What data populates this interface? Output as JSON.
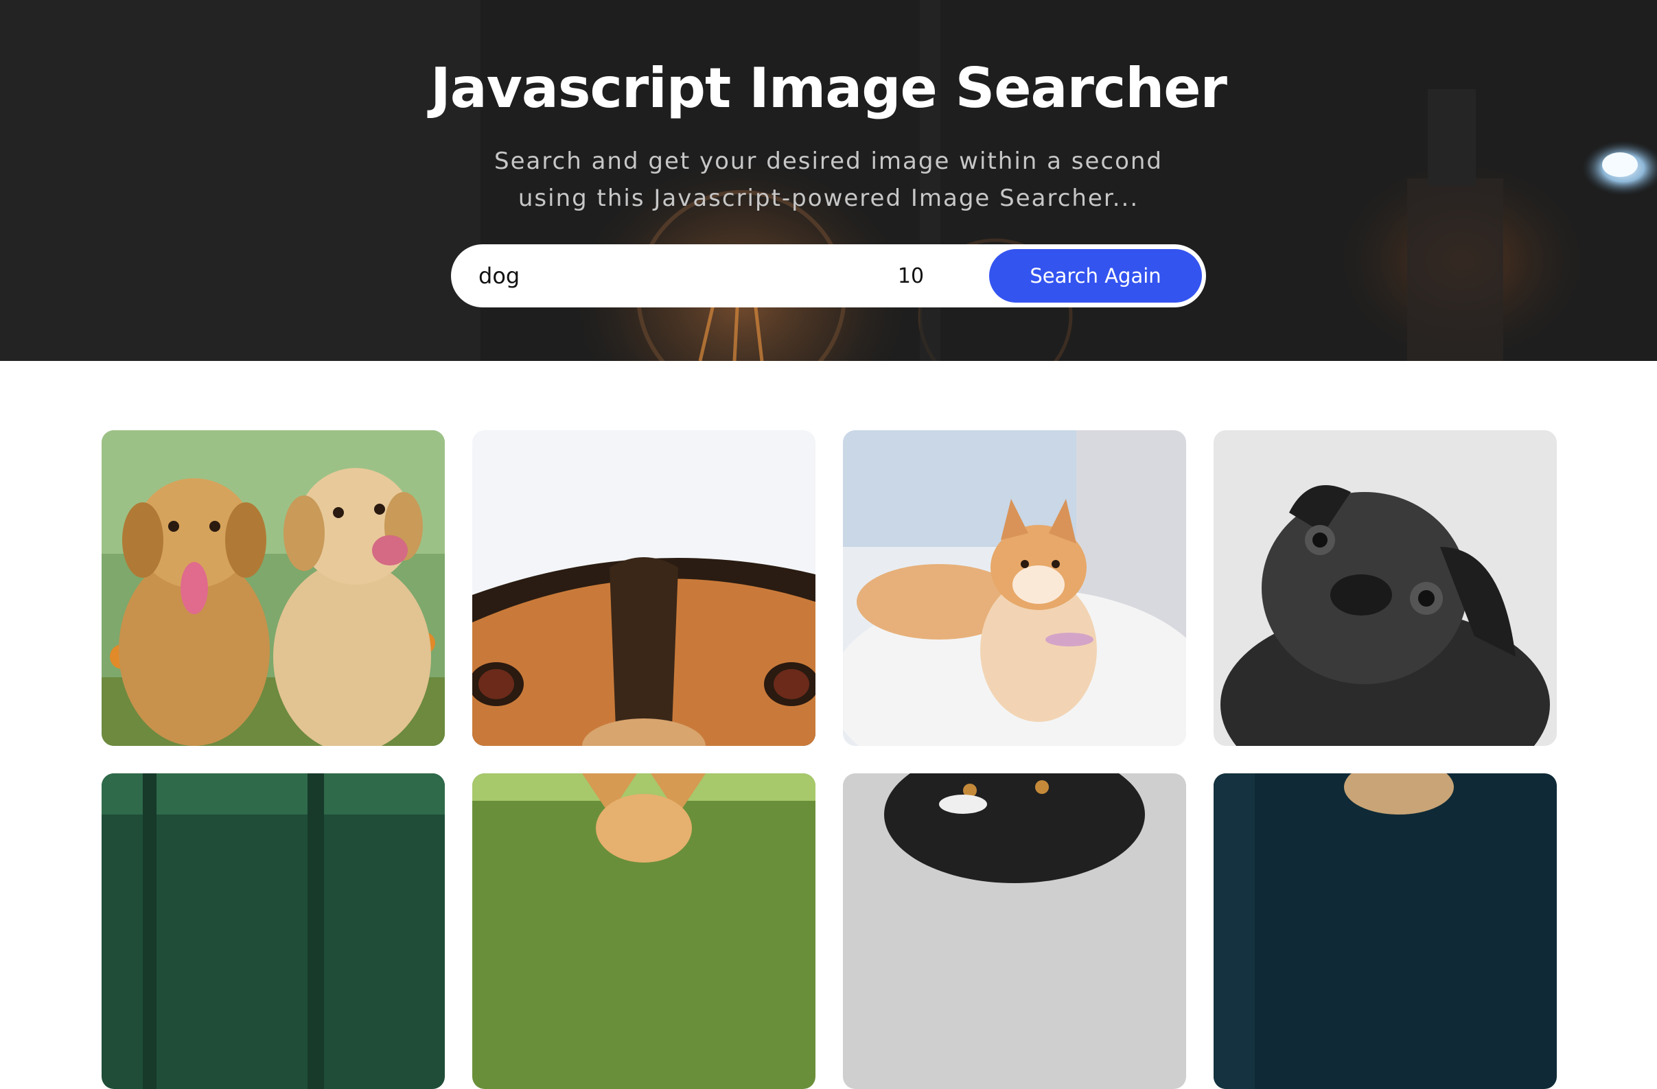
{
  "hero": {
    "title": "Javascript Image Searcher",
    "subtitle_lines": [
      "Search and get your desired image within a second",
      "using this Javascript-powered Image Searcher..."
    ]
  },
  "search": {
    "query": "dog",
    "count": "10",
    "button_label": "Search Again"
  },
  "colors": {
    "accent": "#3454f0",
    "hero_bg": "#1f1f1f"
  },
  "results": [
    {
      "subject": "two golden retriever puppies"
    },
    {
      "subject": "close-up dog eyes"
    },
    {
      "subject": "shiba inu puppy on fur rug"
    },
    {
      "subject": "black pug"
    },
    {
      "subject": "dog in forest"
    },
    {
      "subject": "corgi"
    },
    {
      "subject": "black and white dog"
    },
    {
      "subject": "dog on dark teal background"
    }
  ]
}
